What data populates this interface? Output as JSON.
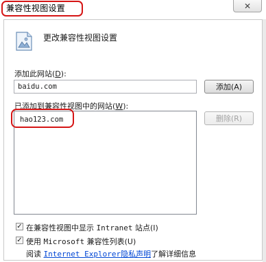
{
  "window": {
    "title": "兼容性视图设置",
    "close_symbol": "✕"
  },
  "dialog": {
    "heading": "更改兼容性视图设置",
    "icon": "picture-settings-icon"
  },
  "add_site": {
    "label": "添加此网站",
    "accel_prefix": "(",
    "accel_key": "D",
    "accel_suffix": "):",
    "value": "baidu.com",
    "button_label": "添加(A)"
  },
  "site_list": {
    "label": "已添加到兼容性视图中的网站",
    "accel_prefix": "(",
    "accel_key": "W",
    "accel_suffix": "):",
    "items": [
      "hao123.com"
    ],
    "remove_button_label": "删除(R)"
  },
  "options": {
    "intranet": {
      "checked": true,
      "label_before": "在兼容性视图中显示 ",
      "label_mono": "Intranet",
      "label_after": " 站点(I)"
    },
    "ms_list": {
      "checked": true,
      "label_before": "使用 ",
      "label_mono": "Microsoft",
      "label_after": " 兼容性列表(U)"
    }
  },
  "footer": {
    "prefix": "阅读 ",
    "link_en": "Internet Explorer",
    "link_cn": "隐私声明",
    "suffix": "了解详细信息"
  },
  "colors": {
    "highlight_red": "#d51414",
    "link_blue": "#0046d5"
  }
}
